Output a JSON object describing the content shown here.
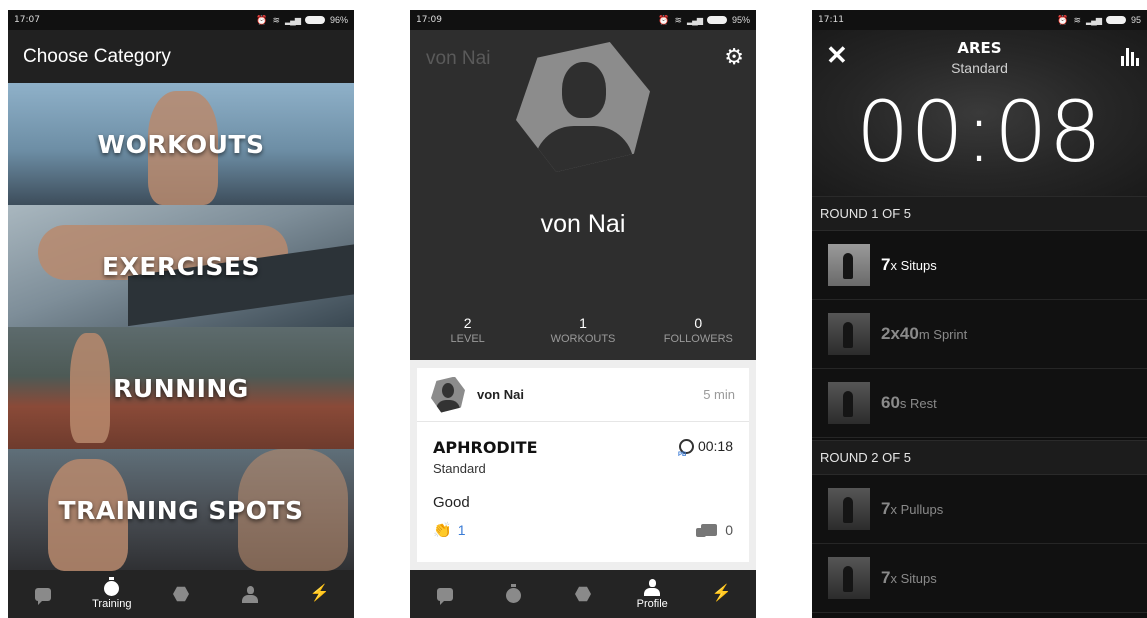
{
  "screen1": {
    "status_time": "17:07",
    "battery": "96%",
    "header_title": "Choose Category",
    "categories": [
      "WORKOUTS",
      "EXERCISES",
      "RUNNING",
      "TRAINING SPOTS"
    ],
    "nav": [
      {
        "icon": "chat-icon",
        "label": ""
      },
      {
        "icon": "stopwatch-icon",
        "label": "Training"
      },
      {
        "icon": "coach-icon",
        "label": ""
      },
      {
        "icon": "profile-icon",
        "label": ""
      },
      {
        "icon": "bolt-icon",
        "label": ""
      }
    ]
  },
  "screen2": {
    "status_time": "17:09",
    "battery": "95%",
    "faded_name": "von Nai",
    "name": "von Nai",
    "stats": [
      {
        "value": "2",
        "label": "LEVEL"
      },
      {
        "value": "1",
        "label": "WORKOUTS"
      },
      {
        "value": "0",
        "label": "FOLLOWERS"
      }
    ],
    "feed": {
      "user": "von Nai",
      "time_ago": "5 min",
      "workout_title": "APHRODITE",
      "workout_level": "Standard",
      "duration": "00:18",
      "note": "Good",
      "applause": "1",
      "comments": "0"
    },
    "nav": [
      {
        "icon": "chat-icon",
        "label": ""
      },
      {
        "icon": "stopwatch-icon",
        "label": ""
      },
      {
        "icon": "coach-icon",
        "label": ""
      },
      {
        "icon": "profile-icon",
        "label": "Profile"
      },
      {
        "icon": "bolt-icon",
        "label": ""
      }
    ]
  },
  "screen3": {
    "status_time": "17:11",
    "battery": "95",
    "workout_title": "ARES",
    "workout_level": "Standard",
    "timer": "00:08",
    "rounds": [
      {
        "label": "ROUND 1 OF 5",
        "exercises": [
          {
            "amount": "7",
            "unit": "x Situps"
          },
          {
            "amount": "2x40",
            "unit": "m Sprint"
          },
          {
            "amount": "60",
            "unit": "s Rest"
          }
        ]
      },
      {
        "label": "ROUND 2 OF 5",
        "exercises": [
          {
            "amount": "7",
            "unit": "x Pullups"
          },
          {
            "amount": "7",
            "unit": "x Situps"
          }
        ]
      }
    ]
  }
}
